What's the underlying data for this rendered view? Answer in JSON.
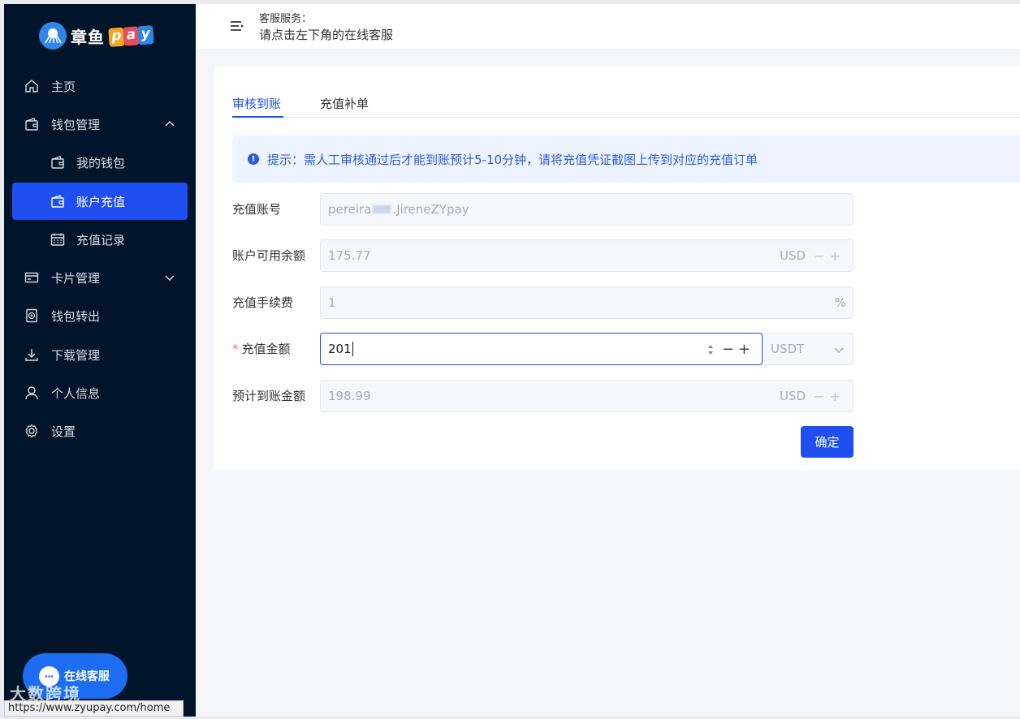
{
  "brand": {
    "name": "章鱼",
    "pay_letters": [
      "p",
      "a",
      "y"
    ],
    "pay_colors": [
      "#f5a623",
      "#e94b5f",
      "#2f86e8"
    ],
    "accent": "#1f4ff0"
  },
  "sidebar": {
    "items": [
      {
        "label": "主页",
        "icon": "home-icon"
      },
      {
        "label": "钱包管理",
        "icon": "wallet-icon",
        "expanded": true
      },
      {
        "label": "我的钱包",
        "icon": "wallet-icon"
      },
      {
        "label": "账户充值",
        "icon": "wallet-icon",
        "active": true
      },
      {
        "label": "充值记录",
        "icon": "calendar-icon"
      },
      {
        "label": "卡片管理",
        "icon": "card-icon",
        "expanded": false
      },
      {
        "label": "钱包转出",
        "icon": "transfer-icon"
      },
      {
        "label": "下载管理",
        "icon": "download-icon"
      },
      {
        "label": "个人信息",
        "icon": "user-icon"
      },
      {
        "label": "设置",
        "icon": "gear-icon"
      }
    ],
    "help_label": "在线客服"
  },
  "header": {
    "service_title": "客服服务：",
    "service_subtitle": "请点击左下角的在线客服"
  },
  "tabs": [
    {
      "label": "审核到账",
      "active": true
    },
    {
      "label": "充值补单",
      "active": false
    }
  ],
  "tip": "提示：需人工审核通过后才能到账预计5-10分钟，请将充值凭证截图上传到对应的充值订单",
  "form": {
    "account": {
      "label": "充值账号",
      "value_prefix": "pereira",
      "value_suffix": ".JireneZYpay"
    },
    "balance": {
      "label": "账户可用余额",
      "value": "175.77",
      "unit": "USD"
    },
    "fee": {
      "label": "充值手续费",
      "value": "1",
      "unit": "%"
    },
    "amount": {
      "label": "充值金额",
      "value": "201",
      "currency": "USDT",
      "required_mark": "*"
    },
    "expected": {
      "label": "预计到账金额",
      "value": "198.99",
      "unit": "USD"
    },
    "stepper": "−+"
  },
  "confirm_label": "确定",
  "status_url": "https://www.zyupay.com/home",
  "watermark": "大数跨境"
}
